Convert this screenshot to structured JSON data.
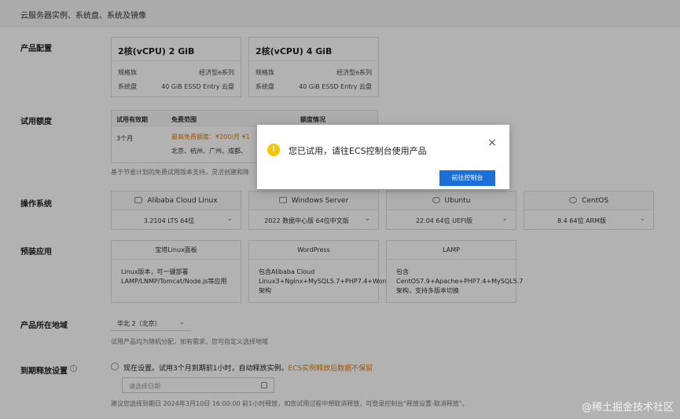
{
  "header": {
    "title": "云服务器实例、系统盘、系统及镜像"
  },
  "sections": {
    "product_config": "产品配置",
    "trial_quota": "试用额度",
    "os": "操作系统",
    "preinstalled": "预装应用",
    "region": "产品所在地域",
    "release": "到期释放设置"
  },
  "product_cards": [
    {
      "title": "2核(vCPU) 2 GiB",
      "spec_label": "规格族",
      "spec_value": "经济型e系列",
      "disk_label": "系统盘",
      "disk_value": "40 GiB ESSD Entry 云盘"
    },
    {
      "title": "2核(vCPU) 4 GiB",
      "spec_label": "规格族",
      "spec_value": "经济型e系列",
      "disk_label": "系统盘",
      "disk_value": "40 GiB ESSD Entry 云盘"
    }
  ],
  "trial": {
    "col_period": "试用有效期",
    "col_scope": "免费范围",
    "col_status": "额度情况",
    "period": "3个月",
    "scope_highlight": "最高免费额度：¥200/月 ¥1",
    "scope_regions": "北京、杭州、广州、成都、",
    "note": "基于节省计划的免费试用版本支持，灵活创建和降"
  },
  "os_cards": [
    {
      "name": "Alibaba Cloud Linux",
      "version": "3.2104 LTS 64位"
    },
    {
      "name": "Windows Server",
      "version": "2022 数据中心版 64位中文版"
    },
    {
      "name": "Ubuntu",
      "version": "22.04 64位 UEFI版"
    },
    {
      "name": "CentOS",
      "version": "8.4 64位 ARM版"
    }
  ],
  "apps": [
    {
      "title": "宝塔Linux面板",
      "desc": "Linux版本，可一键部署LAMP/LNMP/Tomcat/Node.js等应用"
    },
    {
      "title": "WordPress",
      "desc": "包含Alibaba Cloud Linux3+Nginx+MySQL5.7+PHP7.4+Wordpress架构"
    },
    {
      "title": "LAMP",
      "desc": "包含CentOS7.9+Apache+PHP7.4+MySQL5.7架构，支持多版本切换"
    }
  ],
  "region": {
    "value": "华北 2（北京）",
    "note": "试用产品均为随机分配，如有需求，您可自定义选择地域"
  },
  "release": {
    "option_label": "现在设置。试用3个月到期前1小时，自动释放实例。",
    "option_warning": "ECS实例释放后数据不保留",
    "date_placeholder": "请选择日期",
    "footer_note": "建议您选择到期日 2024年3月10日 16:00:00 前1小时释放，如您试用过程中想取消释放，可登录控制台\"释放设置-取消释放\"。"
  },
  "modal": {
    "message": "您已试用，请往ECS控制台使用产品",
    "button": "前往控制台",
    "close": "×",
    "icon_glyph": "!"
  },
  "watermark": "@稀土掘金技术社区",
  "colors": {
    "primary": "#1d6fd8",
    "warning": "#f5c400",
    "accent_orange": "#e07b00"
  }
}
